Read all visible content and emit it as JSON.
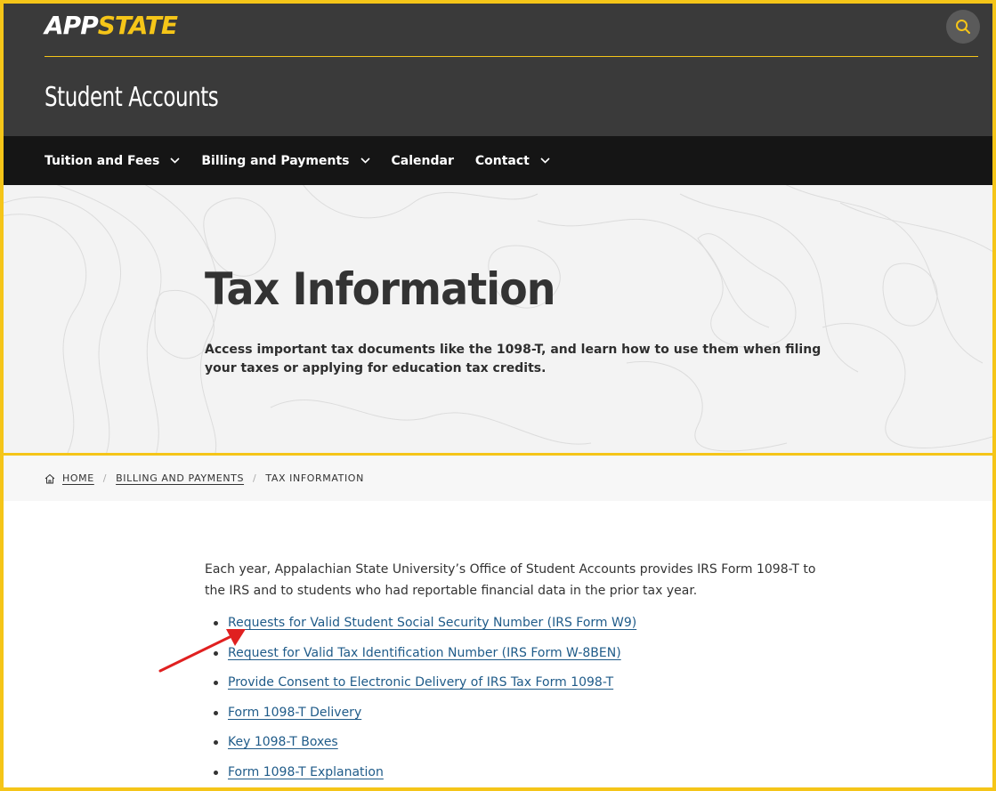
{
  "header": {
    "logo_app": "APP",
    "logo_state": "STATE",
    "site_title": "Student Accounts"
  },
  "nav": {
    "items": [
      {
        "label": "Tuition and Fees",
        "has_dropdown": true
      },
      {
        "label": "Billing and Payments",
        "has_dropdown": true
      },
      {
        "label": "Calendar",
        "has_dropdown": false
      },
      {
        "label": "Contact",
        "has_dropdown": true
      }
    ]
  },
  "hero": {
    "title": "Tax Information",
    "description": "Access important tax documents like the 1098-T, and learn how to use them when filing your taxes or applying for education tax credits."
  },
  "breadcrumb": {
    "home": "HOME",
    "level1": "BILLING AND PAYMENTS",
    "current": "TAX INFORMATION"
  },
  "content": {
    "intro": "Each year, Appalachian State University’s Office of Student Accounts provides IRS Form 1098-T to the IRS and to students who had reportable financial data in the prior tax year.",
    "links": [
      "Requests for Valid Student Social Security Number (IRS Form W9)",
      "Request for Valid Tax Identification Number (IRS Form W-8BEN)",
      "Provide Consent to Electronic Delivery of IRS Tax Form 1098-T",
      "Form 1098-T Delivery",
      "Key 1098-T Boxes",
      "Form 1098-T Explanation"
    ]
  },
  "colors": {
    "brand_yellow": "#f5c518",
    "header_bg": "#3a3a3a",
    "nav_bg": "#151515",
    "link": "#1f5b89",
    "annotation_arrow": "#e02020"
  },
  "icons": {
    "search": "search-icon",
    "dropdown": "chevron-down-icon",
    "home": "home-icon",
    "annotation": "red-arrow-icon"
  }
}
